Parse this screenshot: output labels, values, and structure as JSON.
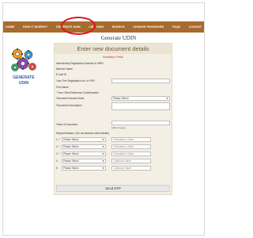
{
  "nav": {
    "items": [
      "HOME",
      "HOW IT WORKS?",
      "GENERATE UDIN",
      "LIST UDIN",
      "SEARCH",
      "CHANGE PASSWORD",
      "FAQS",
      "LOGOUT"
    ],
    "highlight_color": "#e0121c",
    "bar_color": "#a86a2e"
  },
  "page": {
    "title": "Generate UDIN"
  },
  "logo": {
    "text": "GENERATE UDIN"
  },
  "form": {
    "header": "Enter new document details",
    "mandatory_note": "Mandatory Fields",
    "fields": {
      "membership_reg": "Membership Registration Number or MRN",
      "member_name": "Member Name",
      "email": "E-mail ID",
      "firm_reg": "Your Firm Registration No. or FRN",
      "firm_name": "Firm Name",
      "client_ref": "* Your Client Reference Code/Number",
      "doc_issued_under": "*Document Issued Under",
      "doc_issued_under_value": "Please Select",
      "doc_description": "*Document Description",
      "date_of_document": "*Date of Document",
      "date_hint": "(dd/mm/yyyy)",
      "keyword_values": "Keyword/Values: (Do not disclose client details)"
    },
    "keywords": [
      {
        "num": "1. *",
        "select": "Please Select",
        "placeholder": "Mandatory Value"
      },
      {
        "num": "2. *",
        "select": "Please Select",
        "placeholder": "Mandatory Value"
      },
      {
        "num": "3. *",
        "select": "Please Select",
        "placeholder": "Mandatory Value"
      },
      {
        "num": "4.",
        "select": "Please Select",
        "placeholder": "Optional Value"
      },
      {
        "num": "5.",
        "select": "Please Select",
        "placeholder": "Optional Value"
      }
    ],
    "send_button": "Send OTP"
  }
}
